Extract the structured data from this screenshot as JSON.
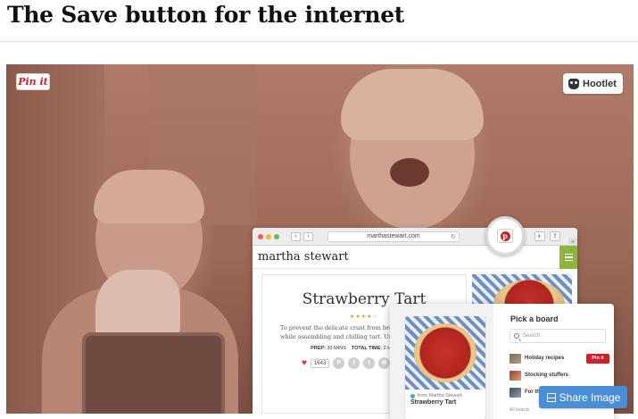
{
  "page": {
    "headline": "The Save button for the internet"
  },
  "overlays": {
    "pin_it_label": "Pin it",
    "hootlet_label": "Hootlet",
    "share_label": "Share Image"
  },
  "browser": {
    "url": "marthastewart.com",
    "site_logo": "martha stewart",
    "article": {
      "title": "Strawberry Tart",
      "stars": "★★★★☆",
      "blurb_line1": "To prevent the delicate crust from breaki",
      "blurb_line2": "while assembling and chilling tart. Unmold",
      "prep_label": "PREP:",
      "prep_value": "30 MINS",
      "total_label": "TOTAL TIME:",
      "total_value": "2 HOURS 30 M",
      "likes": "1643"
    }
  },
  "pin_modal": {
    "source": "from Martha Stewart",
    "pin_title": "Strawberry Tart",
    "pick_board_title": "Pick a board",
    "search_placeholder": "Search",
    "boards": [
      {
        "name": "Holiday recipes",
        "save_label": "Pin it"
      },
      {
        "name": "Stocking stuffers"
      },
      {
        "name": "For th"
      }
    ],
    "all_boards_label": "All boards"
  },
  "colors": {
    "pinterest_red": "#c8232c",
    "share_blue": "#4a8fd6",
    "menu_green": "#8cb43f"
  },
  "icons": [
    "pinterest-logo-icon",
    "owl-icon",
    "search-icon",
    "heart-icon",
    "layers-icon",
    "menu-icon"
  ]
}
